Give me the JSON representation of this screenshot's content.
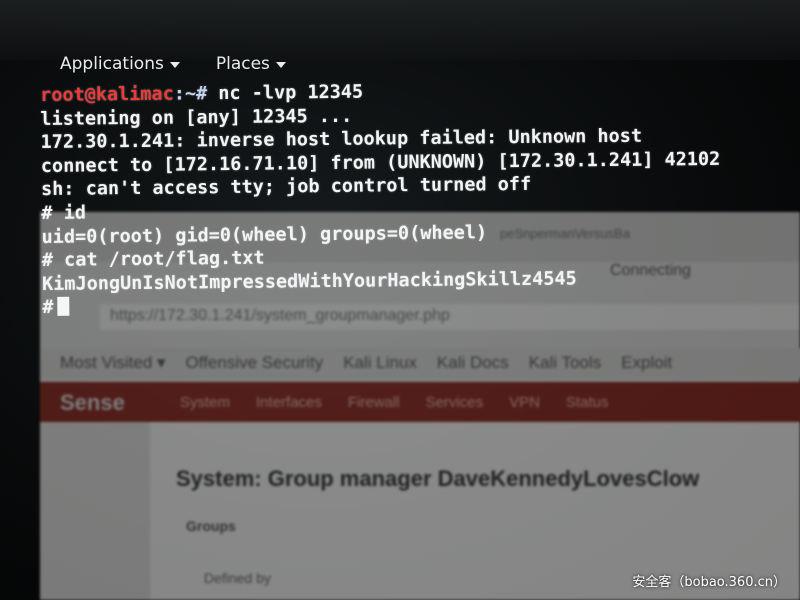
{
  "panel": {
    "applications_label": "Applications",
    "places_label": "Places"
  },
  "terminal": {
    "prompt_user": "root@kalimac",
    "prompt_path": ":~#",
    "lines": [
      "listening on [any] 12345 ...",
      "172.30.1.241: inverse host lookup failed: Unknown host",
      "connect to [172.16.71.10] from (UNKNOWN) [172.30.1.241] 42102",
      "sh: can't access tty; job control turned off",
      "# id",
      "uid=0(root) gid=0(wheel) groups=0(wheel)",
      "# cat /root/flag.txt",
      "KimJongUnIsNotImpressedWithYourHackingSkillz4545",
      "#"
    ],
    "first_command": " nc -lvp 12345"
  },
  "background_browser": {
    "tab_title": "peSnpermanVersusBa",
    "connecting": "Connecting",
    "url": "https://172.30.1.241/system_groupmanager.php",
    "bookmarks": [
      "Most Visited ▾",
      "Offensive Security",
      "Kali Linux",
      "Kali Docs",
      "Kali Tools",
      "Exploit"
    ],
    "brand": "Sense",
    "nav": [
      "System",
      "Interfaces",
      "Firewall",
      "Services",
      "VPN",
      "Status"
    ],
    "heading": "System: Group manager DaveKennedyLovesClow",
    "groups_label": "Groups",
    "defined_by_label": "Defined by"
  },
  "watermark": "安全客（bobao.360.cn）"
}
